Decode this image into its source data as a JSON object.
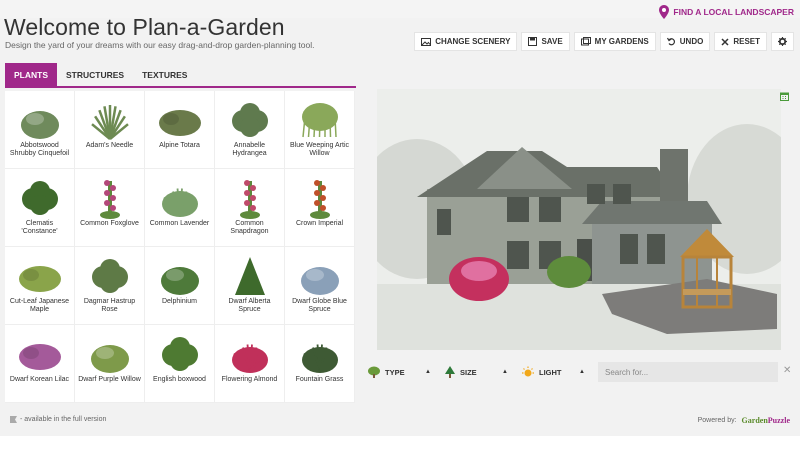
{
  "header": {
    "title": "Welcome to Plan-a-Garden",
    "subtitle": "Design the yard of your dreams with our easy drag-and-drop garden-planning tool.",
    "landscaper_link": "FIND A LOCAL LANDSCAPER"
  },
  "toolbar": {
    "change_scenery": "CHANGE SCENERY",
    "save": "SAVE",
    "my_gardens": "MY GARDENS",
    "undo": "UNDO",
    "reset": "RESET"
  },
  "tabs": [
    {
      "label": "PLANTS",
      "active": true
    },
    {
      "label": "STRUCTURES",
      "active": false
    },
    {
      "label": "TEXTURES",
      "active": false
    }
  ],
  "plants": [
    {
      "name": "Abbotswood Shrubby Cinquefoil",
      "color": "#6f8a5c",
      "shape": "mound"
    },
    {
      "name": "Adam's Needle",
      "color": "#6d8a52",
      "shape": "spiky"
    },
    {
      "name": "Alpine Totara",
      "color": "#6a7a4a",
      "shape": "spread"
    },
    {
      "name": "Annabelle Hydrangea",
      "color": "#5f7a4e",
      "shape": "bush"
    },
    {
      "name": "Blue Weeping Artic Willow",
      "color": "#8aa85a",
      "shape": "weeping"
    },
    {
      "name": "Clematis 'Constance'",
      "color": "#3f6a2c",
      "shape": "bush"
    },
    {
      "name": "Common Foxglove",
      "color": "#b4477a",
      "shape": "spire"
    },
    {
      "name": "Common Lavender",
      "color": "#7aa06a",
      "shape": "grass"
    },
    {
      "name": "Common Snapdragon",
      "color": "#c04a6a",
      "shape": "spire"
    },
    {
      "name": "Crown Imperial",
      "color": "#c0502a",
      "shape": "spire"
    },
    {
      "name": "Cut-Leaf Japanese Maple",
      "color": "#8aa44a",
      "shape": "spread"
    },
    {
      "name": "Dagmar Hastrup Rose",
      "color": "#5e7a46",
      "shape": "bush"
    },
    {
      "name": "Delphinium",
      "color": "#4e7a3a",
      "shape": "mound"
    },
    {
      "name": "Dwarf Alberta Spruce",
      "color": "#3e6a2c",
      "shape": "cone"
    },
    {
      "name": "Dwarf Globe Blue Spruce",
      "color": "#8aa0b8",
      "shape": "mound"
    },
    {
      "name": "Dwarf Korean Lilac",
      "color": "#a45a9a",
      "shape": "spread"
    },
    {
      "name": "Dwarf Purple Willow",
      "color": "#7e9a4a",
      "shape": "mound"
    },
    {
      "name": "English boxwood",
      "color": "#4e7a32",
      "shape": "bush"
    },
    {
      "name": "Flowering Almond",
      "color": "#c0305a",
      "shape": "grass"
    },
    {
      "name": "Fountain Grass",
      "color": "#3e5a34",
      "shape": "grass"
    }
  ],
  "filters": {
    "type": "TYPE",
    "size": "SIZE",
    "light": "LIGHT"
  },
  "search": {
    "placeholder": "Search for...",
    "value": ""
  },
  "footer": {
    "legend": "- available in the full version",
    "powered_by": "Powered by:",
    "brand_a": "Garden",
    "brand_b": "Puzzle"
  },
  "colors": {
    "accent": "#a0288a",
    "panel": "#f2f2f2"
  },
  "icons": {
    "pin": "map-pin-icon",
    "scenery": "image-icon",
    "save": "floppy-icon",
    "gardens": "folder-icon",
    "undo": "undo-icon",
    "reset": "close-icon",
    "settings": "gear-icon"
  }
}
